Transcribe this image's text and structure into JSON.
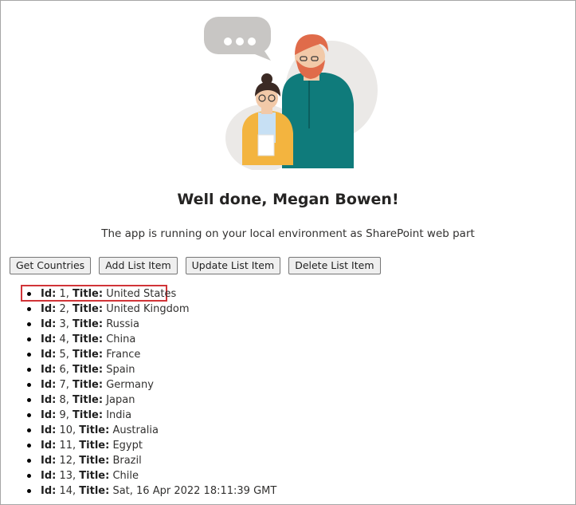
{
  "welcome": {
    "title": "Well done, Megan Bowen!",
    "subtitle": "The app is running on your local environment as SharePoint web part"
  },
  "buttons": {
    "get_countries": "Get Countries",
    "add_list_item": "Add List Item",
    "update_list_item": "Update List Item",
    "delete_list_item": "Delete List Item"
  },
  "list_labels": {
    "id": "Id:",
    "title": "Title:"
  },
  "items": [
    {
      "id": "1",
      "title": "United States"
    },
    {
      "id": "2",
      "title": "United Kingdom"
    },
    {
      "id": "3",
      "title": "Russia"
    },
    {
      "id": "4",
      "title": "China"
    },
    {
      "id": "5",
      "title": "France"
    },
    {
      "id": "6",
      "title": "Spain"
    },
    {
      "id": "7",
      "title": "Germany"
    },
    {
      "id": "8",
      "title": "Japan"
    },
    {
      "id": "9",
      "title": "India"
    },
    {
      "id": "10",
      "title": "Australia"
    },
    {
      "id": "11",
      "title": "Egypt"
    },
    {
      "id": "12",
      "title": "Brazil"
    },
    {
      "id": "13",
      "title": "Chile"
    },
    {
      "id": "14",
      "title": "Sat, 16 Apr 2022 18:11:39 GMT"
    }
  ],
  "colors": {
    "highlight": "#d13438",
    "jacket_teal": "#0f7b7b",
    "sweater_yellow": "#f3b43f",
    "hair_orange": "#e06b4a"
  },
  "icons": {
    "illustration": "welcome-people-illustration",
    "chat": "speech-bubble-icon"
  }
}
